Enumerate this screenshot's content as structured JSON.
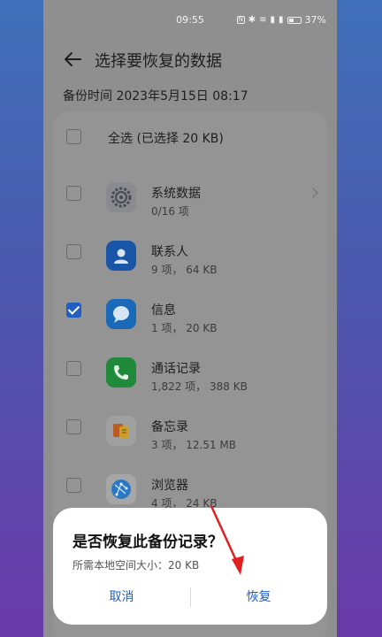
{
  "status_bar": {
    "time": "09:55",
    "nfc": "N",
    "battery": "37%"
  },
  "header": {
    "title": "选择要恢复的数据"
  },
  "backup_time": "备份时间 2023年5月15日 08:17",
  "select_all": {
    "label": "全选 (已选择 20 KB)",
    "checked": false
  },
  "items": [
    {
      "name": "系统数据",
      "detail": "0/16 项",
      "icon": "gear-icon",
      "checked": false,
      "has_chevron": true
    },
    {
      "name": "联系人",
      "detail": "9 项， 64 KB",
      "icon": "contacts-icon",
      "checked": false,
      "has_chevron": false
    },
    {
      "name": "信息",
      "detail": "1 项， 20 KB",
      "icon": "message-icon",
      "checked": true,
      "has_chevron": false
    },
    {
      "name": "通话记录",
      "detail": "1,822 项， 388 KB",
      "icon": "phone-icon",
      "checked": false,
      "has_chevron": false
    },
    {
      "name": "备忘录",
      "detail": "3 项， 12.51 MB",
      "icon": "notes-icon",
      "checked": false,
      "has_chevron": false
    },
    {
      "name": "浏览器",
      "detail": "4 项， 24 KB",
      "icon": "browser-icon",
      "checked": false,
      "has_chevron": false
    }
  ],
  "dialog": {
    "title": "是否恢复此备份记录？",
    "subtitle": "所需本地空间大小：20 KB",
    "cancel_label": "取消",
    "confirm_label": "恢复"
  },
  "colors": {
    "accent": "#1f5ec5",
    "annotation_arrow": "#e02020"
  }
}
